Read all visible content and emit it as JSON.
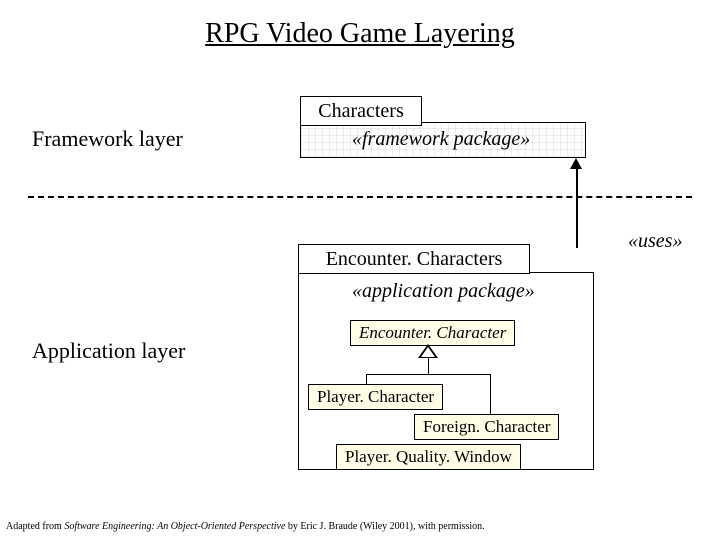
{
  "title": "RPG Video Game Layering",
  "framework": {
    "layer_label": "Framework layer",
    "package_name": "Characters",
    "stereotype": "«framework package»"
  },
  "application": {
    "layer_label": "Application layer",
    "package_name": "Encounter. Characters",
    "stereotype": "«application package»",
    "classes": {
      "encounter_character": "Encounter. Character",
      "player_character": "Player. Character",
      "foreign_character": "Foreign. Character",
      "player_quality_window": "Player. Quality. Window"
    }
  },
  "relation": {
    "uses": "«uses»"
  },
  "citation": {
    "prefix": "Adapted from ",
    "book": "Software Engineering: An Object-Oriented Perspective",
    "suffix": " by Eric J. Braude (Wiley 2001), with permission."
  }
}
